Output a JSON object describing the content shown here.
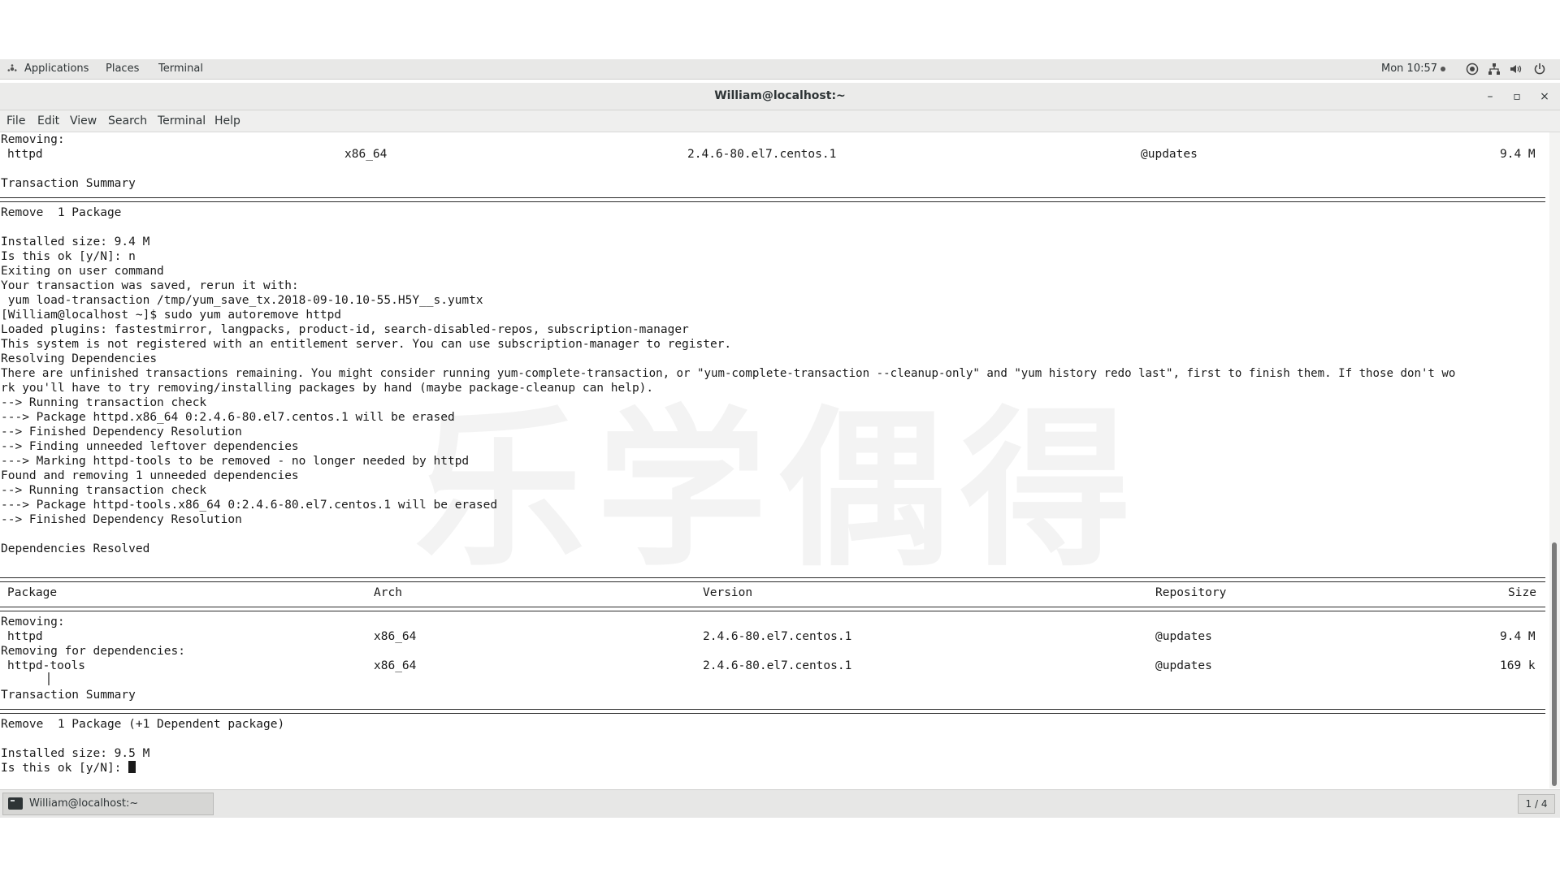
{
  "topbar": {
    "applications": "Applications",
    "places": "Places",
    "terminal": "Terminal",
    "clock": "Mon 10:57"
  },
  "window": {
    "title": "William@localhost:~",
    "minimize": "–",
    "maximize": "▫",
    "close": "×"
  },
  "menubar": [
    "File",
    "Edit",
    "View",
    "Search",
    "Terminal",
    "Help"
  ],
  "terminal": {
    "lines": [
      "Removing:",
      "",
      "",
      "Transaction Summary",
      "",
      "Remove  1 Package",
      "",
      "Installed size: 9.4 M",
      "Is this ok [y/N]: n",
      "Exiting on user command",
      "Your transaction was saved, rerun it with:",
      " yum load-transaction /tmp/yum_save_tx.2018-09-10.10-55.H5Y__s.yumtx",
      "[William@localhost ~]$ sudo yum autoremove httpd",
      "Loaded plugins: fastestmirror, langpacks, product-id, search-disabled-repos, subscription-manager",
      "This system is not registered with an entitlement server. You can use subscription-manager to register.",
      "Resolving Dependencies",
      "There are unfinished transactions remaining. You might consider running yum-complete-transaction, or \"yum-complete-transaction --cleanup-only\" and \"yum history redo last\", first to finish them. If those don't wo",
      "rk you'll have to try removing/installing packages by hand (maybe package-cleanup can help).",
      "--> Running transaction check",
      "---> Package httpd.x86_64 0:2.4.6-80.el7.centos.1 will be erased",
      "--> Finished Dependency Resolution",
      "--> Finding unneeded leftover dependencies",
      "---> Marking httpd-tools to be removed - no longer needed by httpd",
      "Found and removing 1 unneeded dependencies",
      "--> Running transaction check",
      "---> Package httpd-tools.x86_64 0:2.4.6-80.el7.centos.1 will be erased",
      "--> Finished Dependency Resolution",
      "",
      "Dependencies Resolved",
      "",
      "",
      "",
      "",
      "Removing:",
      "",
      "Removing for dependencies:",
      "",
      "",
      "Transaction Summary",
      "",
      "Remove  1 Package (+1 Dependent package)",
      "",
      "Installed size: 9.5 M",
      "Is this ok [y/N]: "
    ],
    "top_row": {
      "package": "httpd",
      "arch": "x86_64",
      "version": "2.4.6-80.el7.centos.1",
      "repo": "@updates",
      "size": "9.4 M"
    },
    "table_header": {
      "package": "Package",
      "arch": "Arch",
      "version": "Version",
      "repository": "Repository",
      "size": "Size"
    },
    "rows": [
      {
        "package": "httpd",
        "arch": "x86_64",
        "version": "2.4.6-80.el7.centos.1",
        "repo": "@updates",
        "size": "9.4 M"
      },
      {
        "package": "httpd-tools",
        "arch": "x86_64",
        "version": "2.4.6-80.el7.centos.1",
        "repo": "@updates",
        "size": "169 k"
      }
    ]
  },
  "watermark": "乐学偶得",
  "taskbar": {
    "task_label": "William@localhost:~",
    "workspace": "1 / 4"
  }
}
